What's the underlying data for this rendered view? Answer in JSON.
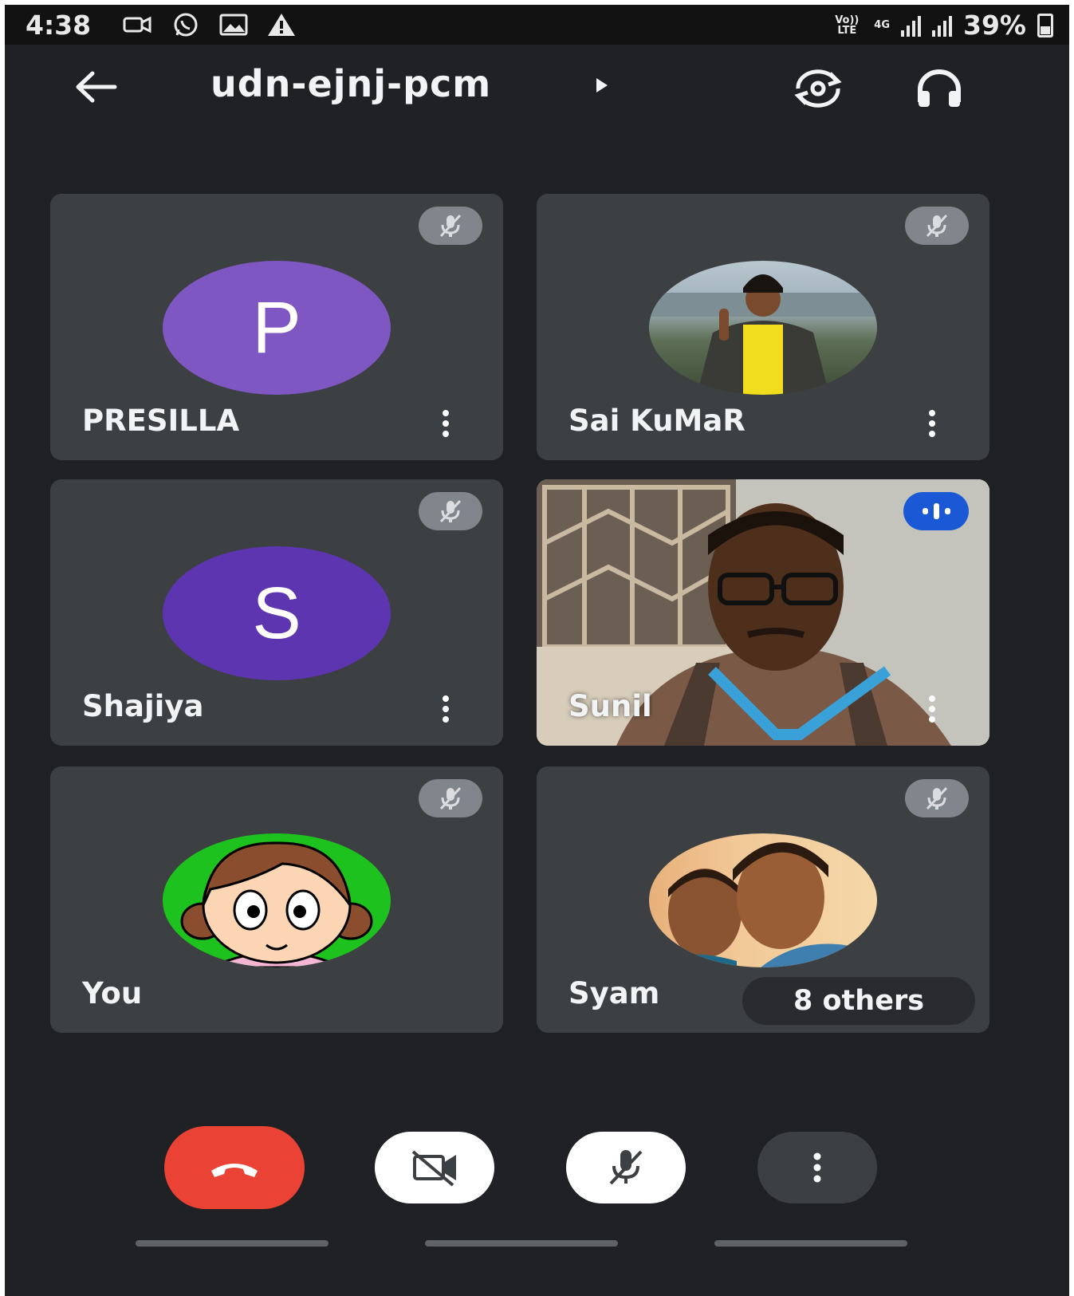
{
  "status_bar": {
    "time": "4:38",
    "volte": "Vo)) LTE",
    "network": "4G",
    "battery": "39%"
  },
  "header": {
    "meeting_code": "udn-ejnj-pcm"
  },
  "participants": [
    {
      "name": "PRESILLA",
      "avatar_letter": "P",
      "avatar_color": "#7e57c2",
      "muted": true
    },
    {
      "name": "Sai KuMaR",
      "avatar_type": "photo",
      "muted": true
    },
    {
      "name": "Shajiya",
      "avatar_letter": "S",
      "avatar_color": "#5e35b1",
      "muted": true
    },
    {
      "name": "Sunil",
      "avatar_type": "video",
      "speaking": true
    },
    {
      "name": "You",
      "avatar_type": "cartoon",
      "muted": true
    },
    {
      "name": "Syam",
      "avatar_type": "photo",
      "muted": true
    }
  ],
  "others_count": "8 others",
  "colors": {
    "background": "#202124",
    "tile": "#3c4043",
    "end_call": "#ea4335",
    "speaking_indicator": "#1a58d6"
  }
}
